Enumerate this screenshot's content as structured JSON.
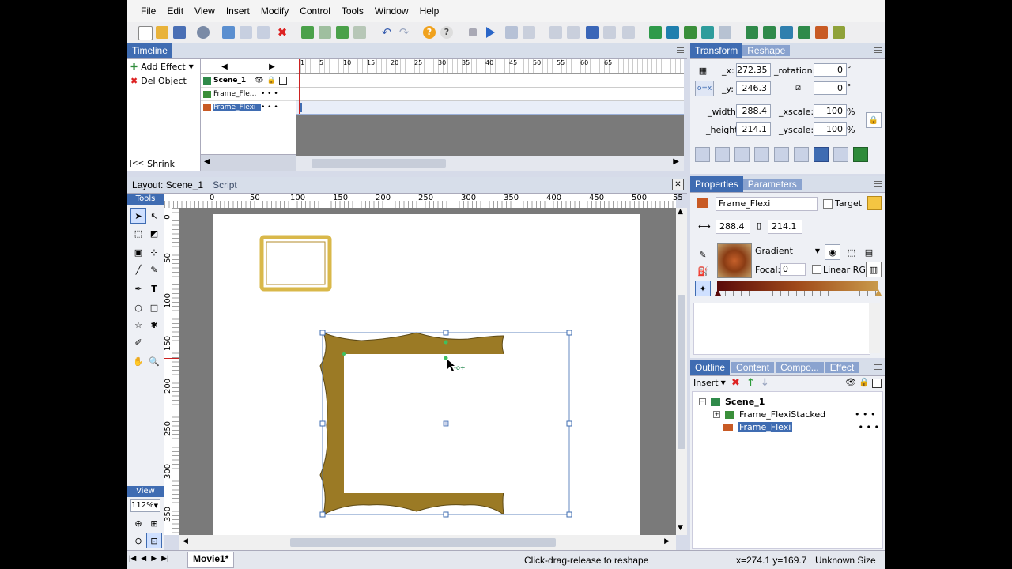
{
  "menu": [
    "File",
    "Edit",
    "View",
    "Insert",
    "Modify",
    "Control",
    "Tools",
    "Window",
    "Help"
  ],
  "timeline": {
    "title": "Timeline",
    "add_effect": "Add Effect",
    "del_object": "Del Object",
    "shrink": "Shrink",
    "ruler_ticks": [
      "1",
      "5",
      "10",
      "15",
      "20",
      "25",
      "30",
      "35",
      "40",
      "45",
      "50",
      "55",
      "60",
      "65"
    ],
    "layers": [
      {
        "name": "Scene_1",
        "dots": "",
        "selected": false
      },
      {
        "name": "Frame_Fle...",
        "dots": "• • •",
        "selected": false
      },
      {
        "name": "Frame_Flexi",
        "dots": "• • •",
        "selected": true
      }
    ]
  },
  "layout": {
    "tab_active": "Layout: Scene_1",
    "tab_script": "Script",
    "tools_label": "Tools",
    "view_label": "View",
    "zoom": "112%",
    "ruler_h": [
      "0",
      "50",
      "100",
      "150",
      "200",
      "250",
      "300",
      "350",
      "400",
      "450",
      "500",
      "55"
    ],
    "ruler_v": [
      "0",
      "50",
      "100",
      "150",
      "200",
      "250",
      "300",
      "350"
    ],
    "movie_tab": "Movie1*"
  },
  "transform": {
    "tab_active": "Transform",
    "tab_reshape": "Reshape",
    "x_label": "_x:",
    "x": "272.35",
    "rotation_label": "_rotation:",
    "rotation": "0",
    "y_label": "_y:",
    "y": "246.3",
    "skew": "0",
    "width_label": "_width:",
    "width": "288.4",
    "xscale_label": "_xscale:",
    "xscale": "100",
    "height_label": "_height:",
    "height": "214.1",
    "yscale_label": "_yscale:",
    "yscale": "100",
    "degree": "°",
    "percent": "%"
  },
  "properties": {
    "tab_active": "Properties",
    "tab_params": "Parameters",
    "name": "Frame_Flexi",
    "target_label": "Target",
    "w": "288.4",
    "h": "214.1",
    "fill_type": "Gradient",
    "focal_label": "Focal:",
    "focal": "0",
    "linear_rgb": "Linear RGB"
  },
  "outline": {
    "tabs": [
      "Outline",
      "Content",
      "Compo...",
      "Effect"
    ],
    "insert": "Insert",
    "scene": "Scene_1",
    "items": [
      {
        "name": "Frame_FlexiStacked",
        "dots": "• • •"
      },
      {
        "name": "Frame_Flexi",
        "dots": "• • •"
      }
    ]
  },
  "status": {
    "hint": "Click-drag-release to reshape",
    "coords": "x=274.1 y=169.7",
    "size": "Unknown Size"
  },
  "colors": {
    "frame_fill": "#9b7a25",
    "selection": "#3f6cb2",
    "small_frame": "#d9b84a"
  },
  "icons": [
    "new-icon",
    "open-icon",
    "save-icon",
    "publish-icon",
    "play-icon",
    "stop-icon",
    "undo-icon",
    "redo-icon",
    "help-icon",
    "arrow-tool-icon",
    "pen-tool-icon",
    "hand-tool-icon",
    "zoom-tool-icon"
  ]
}
